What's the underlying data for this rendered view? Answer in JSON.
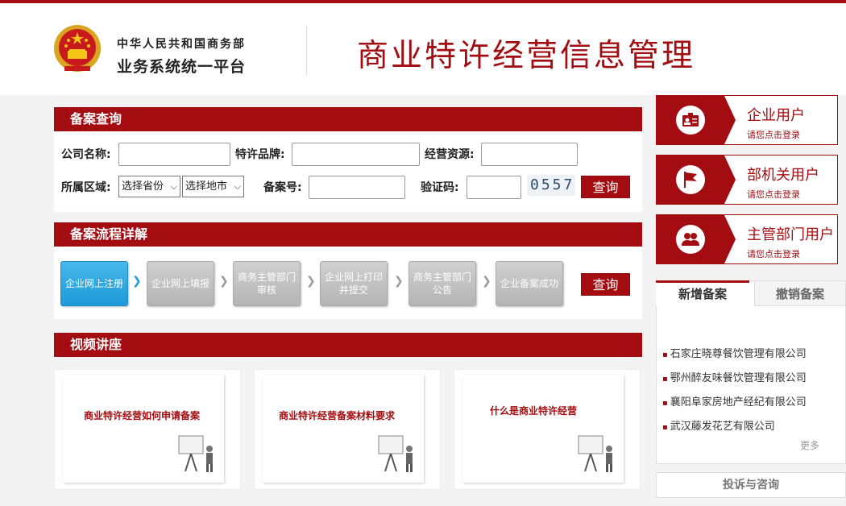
{
  "header": {
    "ministry_line1": "中华人民共和国商务部",
    "ministry_line2": "业务系统统一平台",
    "site_title": "商业特许经营信息管理"
  },
  "search": {
    "section_title": "备案查询",
    "company_label": "公司名称:",
    "brand_label": "特许品牌:",
    "resource_label": "经营资源:",
    "region_label": "所属区域:",
    "province_select": "选择省份",
    "city_select": "选择地市",
    "record_no_label": "备案号:",
    "captcha_label": "验证码:",
    "captcha_value": "0557",
    "query_button": "查询"
  },
  "process": {
    "section_title": "备案流程详解",
    "steps": [
      "企业网上注册",
      "企业网上填报",
      "商务主管部门审核",
      "企业网上打印并提交",
      "商务主管部门公告",
      "企业备案成功"
    ],
    "query_button": "查询"
  },
  "videos": {
    "section_title": "视频讲座",
    "items": [
      "商业特许经营如何申请备案",
      "商业特许经营备案材料要求",
      "什么是商业特许经营"
    ]
  },
  "users": [
    {
      "name": "企业用户",
      "sub": "请您点击登录",
      "icon": "id-card-icon"
    },
    {
      "name": "部机关用户",
      "sub": "请您点击登录",
      "icon": "flag-icon"
    },
    {
      "name": "主管部门用户",
      "sub": "请您点击登录",
      "icon": "users-icon"
    }
  ],
  "records": {
    "tab_new": "新增备案",
    "tab_revoked": "撤销备案",
    "items": [
      "石家庄晓尊餐饮管理有限公司",
      "鄂州醉友味餐饮管理有限公司",
      "襄阳阜家房地产经纪有限公司",
      "武汉藤发花艺有限公司"
    ],
    "more": "更多"
  },
  "complaint": "投诉与咨询",
  "colors": {
    "brand_red": "#a30c10",
    "step_active": "#1d9ad8",
    "step_inactive": "#b4b4b4"
  }
}
